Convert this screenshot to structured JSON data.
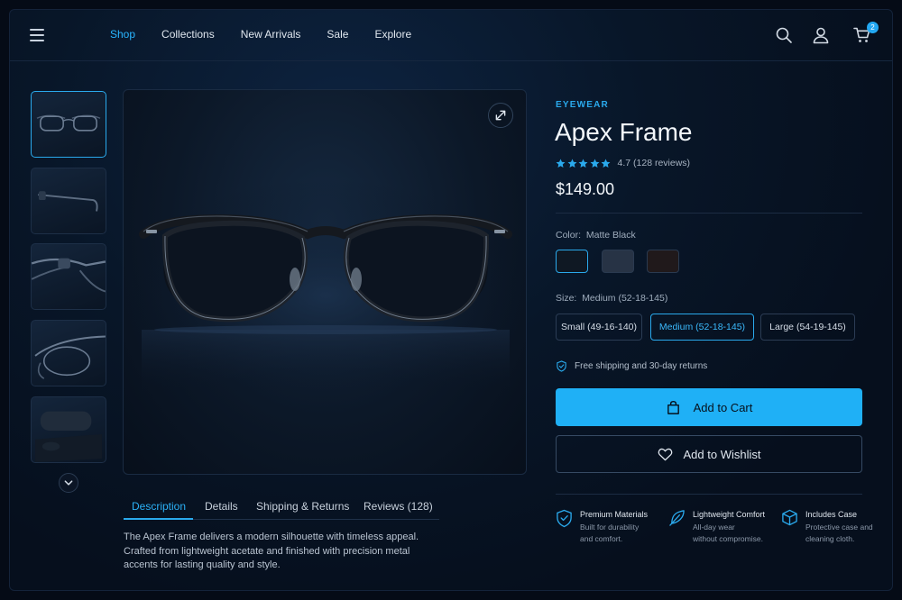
{
  "nav": {
    "links": [
      "Shop",
      "Collections",
      "New Arrivals",
      "Sale",
      "Explore"
    ],
    "active_link": "Shop",
    "cart_count": "2"
  },
  "product": {
    "category": "EYEWEAR",
    "title": "Apex Frame",
    "rating": 4.7,
    "rating_text": "4.7 (128 reviews)",
    "price": "$149.00",
    "color_label": "Color:",
    "color_value": "Matte Black",
    "color_options": [
      {
        "name": "Matte Black",
        "hex": "#0f1823"
      },
      {
        "name": "Slate",
        "hex": "#273345"
      },
      {
        "name": "Tortoise",
        "hex": "#20191b"
      }
    ],
    "size_label": "Size:",
    "size_value": "Medium (52-18-145)",
    "sizes": [
      "Small (49-16-140)",
      "Medium (52-18-145)",
      "Large (54-19-145)"
    ],
    "shipping_note": "Free shipping and 30-day returns",
    "add_to_cart": "Add to Cart",
    "add_to_wishlist": "Add to Wishlist"
  },
  "tabs": [
    "Description",
    "Details",
    "Shipping & Returns",
    "Reviews (128)"
  ],
  "active_tab": "Description",
  "description": "The Apex Frame delivers a modern silhouette with timeless appeal. Crafted from lightweight acetate and finished with precision metal accents for lasting quality and style.",
  "features": [
    {
      "icon": "shield-icon",
      "title": "Premium Materials",
      "line1": "Built for durability",
      "line2": "and comfort."
    },
    {
      "icon": "feather-icon",
      "title": "Lightweight Comfort",
      "line1": "All-day wear",
      "line2": "without compromise."
    },
    {
      "icon": "box-icon",
      "title": "Includes Case",
      "line1": "Protective case and",
      "line2": "cleaning cloth."
    }
  ],
  "colors": {
    "accent": "#1fb0f6",
    "background": "#060f1d"
  }
}
